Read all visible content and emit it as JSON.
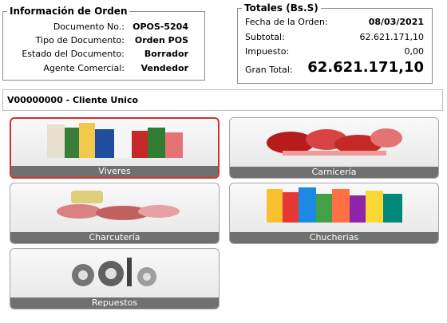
{
  "order": {
    "title": "Información de Orden",
    "rows": [
      {
        "label": "Documento No.:",
        "value": "OPOS-5204"
      },
      {
        "label": "Tipo de Documento:",
        "value": "Orden POS"
      },
      {
        "label": "Estado del Documento:",
        "value": "Borrador"
      },
      {
        "label": "Agente Comercial:",
        "value": "Vendedor"
      }
    ]
  },
  "totals": {
    "title": "Totales (Bs.S)",
    "date_label": "Fecha de la Orden:",
    "date_value": "08/03/2021",
    "subtotal_label": "Subtotal:",
    "subtotal_value": "62.621.171,10",
    "tax_label": "Impuesto:",
    "tax_value": "0,00",
    "grand_label": "Gran Total:",
    "grand_value": "62.621.171,10"
  },
  "client": {
    "name": "V00000000 - Cliente Unico"
  },
  "categories": [
    {
      "label": "Viveres",
      "selected": true
    },
    {
      "label": "Carnicería",
      "selected": false
    },
    {
      "label": "Charcutería",
      "selected": false
    },
    {
      "label": "Chucherias",
      "selected": false
    },
    {
      "label": "Repuestos",
      "selected": false
    }
  ],
  "colors": {
    "selected_border": "#d32f2f",
    "caption_bg": "#707070"
  }
}
